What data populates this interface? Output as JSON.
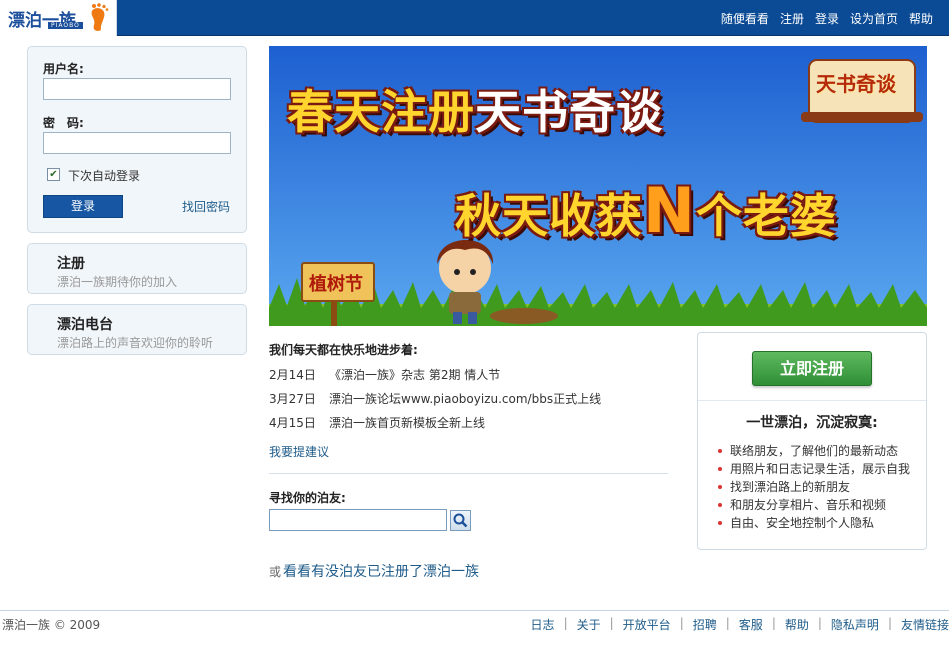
{
  "header": {
    "logo_text": "漂泊一族",
    "logo_sub": "PIAOBO",
    "nav": [
      "随便看看",
      "注册",
      "登录",
      "设为首页",
      "帮助"
    ]
  },
  "login": {
    "username_label": "用户名:",
    "password_label": "密　码:",
    "remember_label": "下次自动登录",
    "remember_checked": true,
    "login_button": "登录",
    "forgot_link": "找回密码"
  },
  "side_cards": [
    {
      "title": "注册",
      "subtitle": "漂泊一族期待你的加入"
    },
    {
      "title": "漂泊电台",
      "subtitle": "漂泊路上的声音欢迎你的聆听"
    }
  ],
  "banner": {
    "line1_a": "春天注册",
    "line1_b": "天书奇谈",
    "line2_a": "秋天收获",
    "line2_big": "N",
    "line2_b": "个老婆",
    "badge": "天书奇谈",
    "sign": "植树节"
  },
  "news": {
    "title": "我们每天都在快乐地进步着:",
    "items": [
      {
        "date": "2月14日",
        "text": "《漂泊一族》杂志 第2期 情人节"
      },
      {
        "date": "3月27日",
        "text": "漂泊一族论坛www.piaoboyizu.com/bbs正式上线"
      },
      {
        "date": "4月15日",
        "text": "漂泊一族首页新模板全新上线"
      }
    ],
    "suggest_link": "我要提建议"
  },
  "find": {
    "title": "寻找你的泊友:",
    "input_value": "",
    "or_label": "或",
    "see_link": "看看有没泊友已注册了漂泊一族"
  },
  "register_panel": {
    "button": "立即注册",
    "slogan": "一世漂泊，沉淀寂寞:",
    "features": [
      "联络朋友，了解他们的最新动态",
      "用照片和日志记录生活，展示自我",
      "找到漂泊路上的新朋友",
      "和朋友分享相片、音乐和视频",
      "自由、安全地控制个人隐私"
    ]
  },
  "footer": {
    "copyright": "漂泊一族 © 2009",
    "links": [
      "日志",
      "关于",
      "开放平台",
      "招聘",
      "客服",
      "帮助",
      "隐私声明",
      "友情链接"
    ],
    "separator": "|"
  },
  "colors": {
    "header_bg": "#0b4a94",
    "link": "#1f5c8a",
    "register_green": "#3a9a3f",
    "banner_sky": "#2a6fd2",
    "banner_text": "#ffd52e"
  }
}
